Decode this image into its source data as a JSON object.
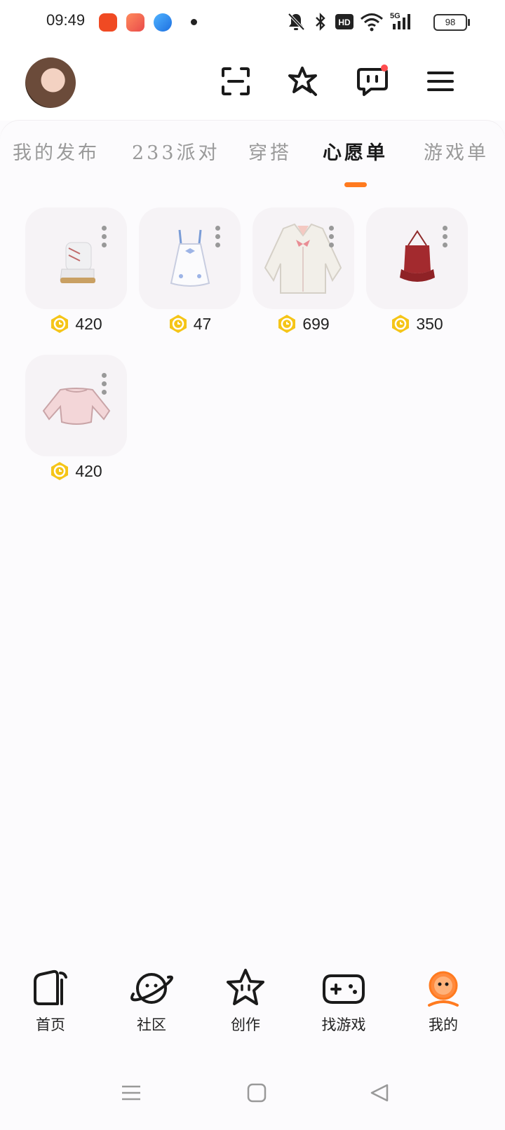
{
  "status_bar": {
    "time": "09:49",
    "battery": "98",
    "hd": "HD",
    "network": "5G"
  },
  "header": {
    "avatar": "user-avatar",
    "icons": [
      "scan-icon",
      "star-wand-icon",
      "message-icon",
      "menu-icon"
    ]
  },
  "tabs": [
    {
      "label": "我的发布",
      "active": false
    },
    {
      "label": "233派对",
      "active": false
    },
    {
      "label": "穿搭",
      "active": false
    },
    {
      "label": "心愿单",
      "active": true
    },
    {
      "label": "游戏单",
      "active": false
    }
  ],
  "wishlist": [
    {
      "name": "white-boots-item",
      "price": "420"
    },
    {
      "name": "white-dress-item",
      "price": "47"
    },
    {
      "name": "cardigan-item",
      "price": "699"
    },
    {
      "name": "red-halter-top-item",
      "price": "350"
    },
    {
      "name": "pink-offshoulder-top-item",
      "price": "420"
    }
  ],
  "bottom_nav": [
    {
      "label": "首页",
      "icon": "home-icon",
      "active": false
    },
    {
      "label": "社区",
      "icon": "planet-icon",
      "active": false
    },
    {
      "label": "创作",
      "icon": "star-face-icon",
      "active": false
    },
    {
      "label": "找游戏",
      "icon": "gamepad-icon",
      "active": false
    },
    {
      "label": "我的",
      "icon": "profile-face-icon",
      "active": true
    }
  ],
  "colors": {
    "accent": "#ff7a1f",
    "coin": "#f5c518",
    "notification": "#ff4d4f"
  }
}
